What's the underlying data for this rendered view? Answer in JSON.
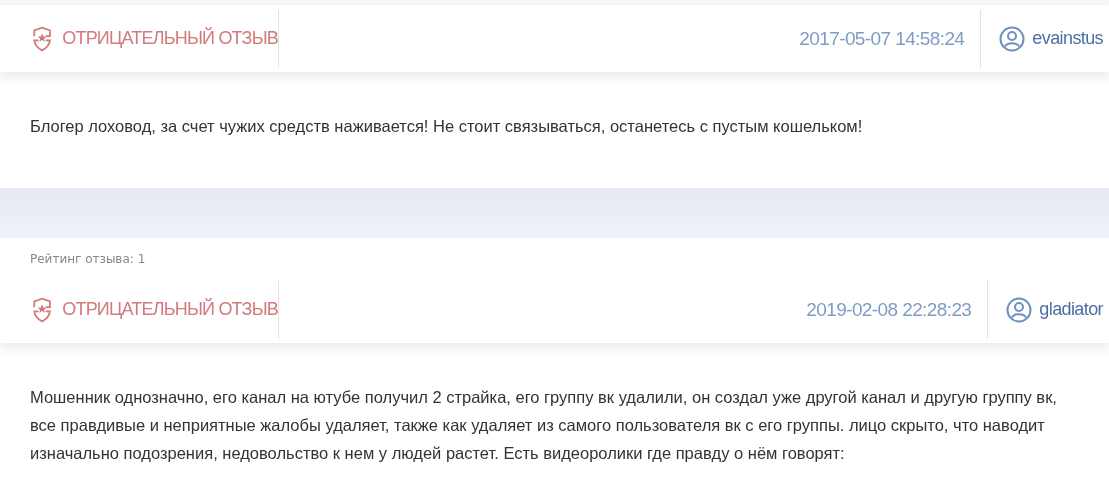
{
  "items": [
    {
      "kind": "review",
      "label": "ОТРИЦАТЕЛЬНЫЙ ОТЗЫВ",
      "date": "2017-05-07 14:58:24",
      "author": "evainstus",
      "text": "Блогер лоховод, за счет чужих средств наживается! Не стоит связываться, останетесь с пустым кошельком!"
    },
    {
      "kind": "separator"
    },
    {
      "kind": "rating",
      "text": "Рейтинг отзыва: 1"
    },
    {
      "kind": "review",
      "label": "ОТРИЦАТЕЛЬНЫЙ ОТЗЫВ",
      "date": "2019-02-08 22:28:23",
      "author": "gladiator",
      "text": "Мошенник однозначно, его канал на ютубе получил 2 страйка, его группу вк удалили, он создал уже другой канал и другую группу вк, все правдивые и неприятные жалобы удаляет, также как удаляет из самого пользователя вк с его группы. лицо скрыто, что наводит изначально подозрения, недовольство к нем у людей растет. Есть видеоролики где правду о нём говорят:"
    }
  ]
}
